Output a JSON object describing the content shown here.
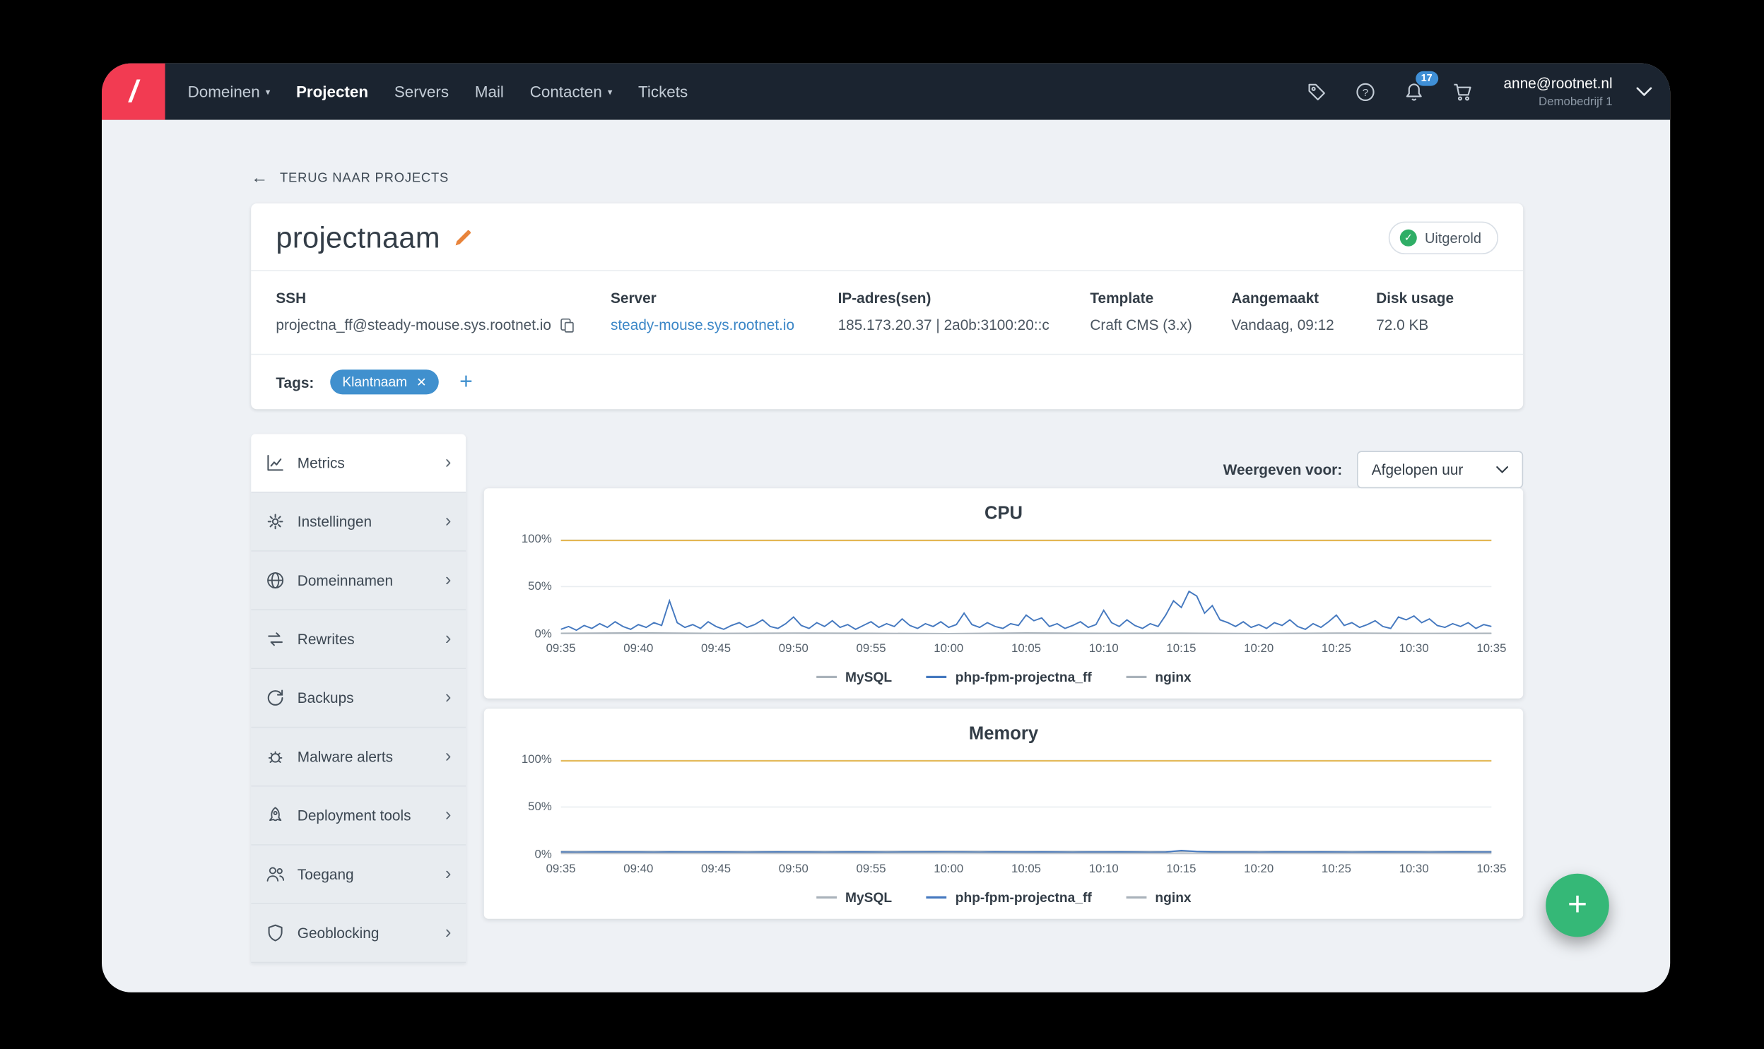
{
  "navbar": {
    "logo_text": "/",
    "items": [
      {
        "label": "Domeinen",
        "dropdown": true,
        "active": false
      },
      {
        "label": "Projecten",
        "dropdown": false,
        "active": true
      },
      {
        "label": "Servers",
        "dropdown": false,
        "active": false
      },
      {
        "label": "Mail",
        "dropdown": false,
        "active": false
      },
      {
        "label": "Contacten",
        "dropdown": true,
        "active": false
      },
      {
        "label": "Tickets",
        "dropdown": false,
        "active": false
      }
    ],
    "notification_count": "17",
    "account_email": "anne@rootnet.nl",
    "account_company": "Demobedrijf 1"
  },
  "page": {
    "back_link": "TERUG NAAR PROJECTS",
    "project_name": "projectnaam",
    "status_label": "Uitgerold",
    "info_columns": [
      {
        "label": "SSH",
        "value": "projectna_ff@steady-mouse.sys.rootnet.io",
        "type": "copy"
      },
      {
        "label": "Server",
        "value": "steady-mouse.sys.rootnet.io",
        "type": "link"
      },
      {
        "label": "IP-adres(sen)",
        "value": "185.173.20.37 | 2a0b:3100:20::c",
        "type": "text"
      },
      {
        "label": "Template",
        "value": "Craft CMS (3.x)",
        "type": "text"
      },
      {
        "label": "Aangemaakt",
        "value": "Vandaag, 09:12",
        "type": "text"
      },
      {
        "label": "Disk usage",
        "value": "72.0 KB",
        "type": "text"
      }
    ],
    "tags_label": "Tags:",
    "tags": [
      "Klantnaam"
    ]
  },
  "sidebar": {
    "items": [
      {
        "label": "Metrics",
        "icon": "chart-icon",
        "active": true
      },
      {
        "label": "Instellingen",
        "icon": "gear-icon",
        "active": false
      },
      {
        "label": "Domeinnamen",
        "icon": "globe-icon",
        "active": false
      },
      {
        "label": "Rewrites",
        "icon": "rewrite-icon",
        "active": false
      },
      {
        "label": "Backups",
        "icon": "history-icon",
        "active": false
      },
      {
        "label": "Malware alerts",
        "icon": "malware-icon",
        "active": false
      },
      {
        "label": "Deployment tools",
        "icon": "rocket-icon",
        "active": false
      },
      {
        "label": "Toegang",
        "icon": "users-icon",
        "active": false
      },
      {
        "label": "Geoblocking",
        "icon": "shield-icon",
        "active": false
      }
    ]
  },
  "metrics": {
    "filter_label": "Weergeven voor:",
    "filter_value": "Afgelopen uur"
  },
  "fab_label": "+",
  "colors": {
    "brand_red": "#f23b52",
    "accent_blue": "#3c87c7",
    "tag_blue": "#4090ce",
    "green": "#35b877",
    "chart_yellow": "#e3b44c",
    "chart_blue": "#4478bf",
    "chart_gray": "#a9b2ba"
  },
  "chart_data": [
    {
      "type": "line",
      "title": "CPU",
      "ylim": [
        0,
        100
      ],
      "y_ticks": [
        "100%",
        "50%",
        "0%"
      ],
      "x_ticks": [
        "09:35",
        "09:40",
        "09:45",
        "09:50",
        "09:55",
        "10:00",
        "10:05",
        "10:10",
        "10:15",
        "10:20",
        "10:25",
        "10:30",
        "10:35"
      ],
      "limit_line": 100,
      "grid": true,
      "legend_position": "bottom",
      "series": [
        {
          "name": "MySQL",
          "color": "#a9b2ba",
          "values": [
            1,
            1.4,
            0.8,
            1.2,
            1,
            0.6,
            1.3,
            0.9,
            1.1,
            0.7,
            1.2,
            0.8,
            1
          ]
        },
        {
          "name": "php-fpm-projectna_ff",
          "color": "#4478bf",
          "values": [
            5,
            8,
            4,
            9,
            6,
            11,
            7,
            13,
            8,
            5,
            10,
            7,
            12,
            9,
            35,
            12,
            7,
            10,
            6,
            13,
            8,
            5,
            9,
            12,
            7,
            10,
            15,
            8,
            6,
            11,
            18,
            9,
            6,
            12,
            8,
            14,
            7,
            10,
            5,
            9,
            13,
            7,
            11,
            8,
            16,
            9,
            6,
            11,
            8,
            13,
            7,
            10,
            22,
            10,
            7,
            12,
            8,
            6,
            11,
            9,
            20,
            14,
            17,
            8,
            11,
            6,
            9,
            13,
            7,
            10,
            25,
            12,
            8,
            15,
            9,
            6,
            11,
            8,
            20,
            35,
            28,
            45,
            40,
            22,
            30,
            15,
            12,
            8,
            13,
            7,
            10,
            6,
            12,
            9,
            15,
            8,
            5,
            11,
            7,
            13,
            20,
            9,
            12,
            7,
            10,
            14,
            8,
            6,
            18,
            15,
            19,
            12,
            16,
            9,
            7,
            11,
            8,
            12,
            6,
            10,
            8
          ]
        },
        {
          "name": "nginx",
          "color": "#a9b2ba",
          "values": [
            0.5,
            0.8,
            0.4,
            0.9,
            0.6,
            0.5,
            0.8,
            0.4,
            0.7,
            0.5,
            0.9,
            0.6,
            0.5
          ]
        }
      ]
    },
    {
      "type": "line",
      "title": "Memory",
      "ylim": [
        0,
        100
      ],
      "y_ticks": [
        "100%",
        "50%",
        "0%"
      ],
      "x_ticks": [
        "09:35",
        "09:40",
        "09:45",
        "09:50",
        "09:55",
        "10:00",
        "10:05",
        "10:10",
        "10:15",
        "10:20",
        "10:25",
        "10:30",
        "10:35"
      ],
      "limit_line": 100,
      "grid": true,
      "legend_position": "bottom",
      "series": [
        {
          "name": "MySQL",
          "color": "#a9b2ba",
          "values": [
            3.3,
            3.3,
            3.2,
            3.3,
            3.3,
            3.4,
            3.3,
            3.3,
            3.2,
            3.3,
            3.3,
            3.3,
            3.3
          ]
        },
        {
          "name": "php-fpm-projectna_ff",
          "color": "#4478bf",
          "values": [
            2.5,
            2.4,
            2.5,
            2.6,
            2.5,
            2.5,
            2.4,
            2.6,
            2.5,
            2.5,
            2.6,
            2.5,
            2.4,
            2.5,
            2.6,
            2.5,
            2.5,
            2.4,
            2.5,
            2.6,
            2.5,
            2.4,
            2.5,
            2.5,
            2.6,
            2.5,
            2.5,
            2.4,
            2.6,
            2.5,
            2.5,
            2.6,
            2.5,
            2.4,
            2.5,
            2.5,
            2.6,
            2.5,
            2.4,
            2.5,
            4.2,
            3.1,
            2.6,
            2.5,
            2.5,
            2.4,
            2.6,
            2.5,
            2.5,
            2.6,
            2.5,
            2.4,
            2.5,
            2.6,
            2.5,
            2.5,
            2.4,
            2.5,
            2.6,
            2.5,
            2.5
          ]
        },
        {
          "name": "nginx",
          "color": "#a9b2ba",
          "values": [
            1.6,
            1.6,
            1.5,
            1.6,
            1.6,
            1.7,
            1.6,
            1.6,
            1.5,
            1.6,
            1.6,
            1.6,
            1.6
          ]
        }
      ]
    }
  ]
}
